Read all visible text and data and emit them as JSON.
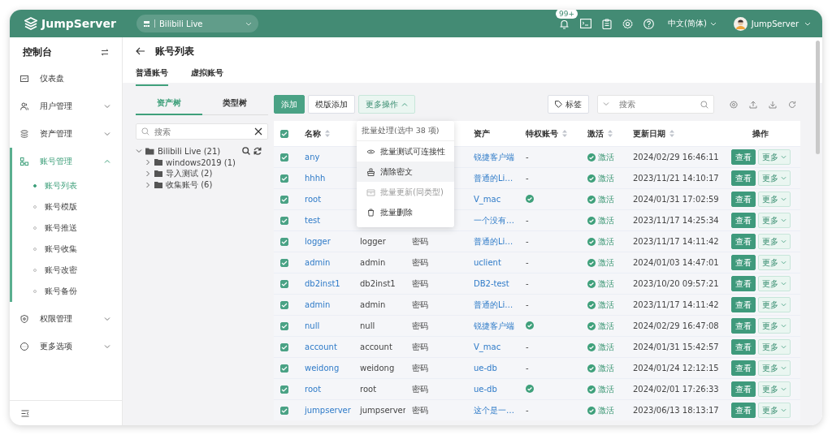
{
  "header": {
    "logo": "JumpServer",
    "org": "Bilibili Live",
    "notification_badge": "99+",
    "language": "中文(简体)",
    "user": "JumpServer"
  },
  "sidebar": {
    "title": "控制台",
    "items": [
      {
        "label": "仪表盘",
        "selected": false
      },
      {
        "label": "用户管理",
        "expanded": false,
        "selected": false
      },
      {
        "label": "资产管理",
        "expanded": false,
        "selected": false
      },
      {
        "label": "账号管理",
        "expanded": true,
        "selected": true,
        "children": [
          {
            "label": "账号列表",
            "selected": true
          },
          {
            "label": "账号模版",
            "selected": false
          },
          {
            "label": "账号推送",
            "selected": false
          },
          {
            "label": "账号收集",
            "selected": false
          },
          {
            "label": "账号改密",
            "selected": false
          },
          {
            "label": "账号备份",
            "selected": false
          }
        ]
      },
      {
        "label": "权限管理",
        "expanded": false,
        "selected": false
      },
      {
        "label": "更多选项",
        "expanded": false,
        "selected": false
      }
    ]
  },
  "page": {
    "title": "账号列表",
    "tabs": [
      {
        "label": "普通账号",
        "selected": true
      },
      {
        "label": "虚拟账号",
        "selected": false
      }
    ]
  },
  "tree": {
    "tabs": [
      {
        "label": "资产树",
        "selected": true
      },
      {
        "label": "类型树",
        "selected": false
      }
    ],
    "search": {
      "placeholder": "搜索"
    },
    "nodes": [
      {
        "label": "Bilibili Live (21)",
        "expanded": true,
        "children": [
          {
            "label": "windows2019 (1)",
            "expanded": false
          },
          {
            "label": "导入测试 (2)",
            "expanded": false
          },
          {
            "label": "收集账号 (6)",
            "expanded": false
          }
        ]
      }
    ]
  },
  "toolbar": {
    "buttons": [
      {
        "label": "添加",
        "kind": "primary"
      },
      {
        "label": "模版添加",
        "kind": "default"
      },
      {
        "label": "更多操作",
        "kind": "menu",
        "open": true
      }
    ],
    "tag_button": "标签",
    "search": {
      "placeholder": "搜索"
    }
  },
  "menu": {
    "title": "批量处理(选中 38 项)",
    "items": [
      {
        "label": "批量测试可连接性",
        "disabled": false,
        "hovered": false
      },
      {
        "label": "清除密文",
        "disabled": false,
        "hovered": true
      },
      {
        "label": "批量更新(同类型)",
        "disabled": true,
        "hovered": false
      },
      {
        "label": "批量删除",
        "disabled": false,
        "hovered": false
      }
    ]
  },
  "table": {
    "all_checked": true,
    "columns": [
      {
        "label": "名称",
        "sortable": true
      },
      {
        "label": "资产",
        "sortable": false
      },
      {
        "label": "特权账号",
        "sortable": true
      },
      {
        "label": "激活",
        "sortable": true
      },
      {
        "label": "更新日期",
        "sortable": true
      },
      {
        "label": "操作",
        "sortable": false
      }
    ],
    "rows": [
      {
        "checked": true,
        "name": "any",
        "asset": "锐捷客户端",
        "privileged": false,
        "privileged_label": "-",
        "active": true,
        "status": "激活",
        "updated": "2024/02/29 16:46:11",
        "actions": [
          "查看",
          "更多"
        ]
      },
      {
        "checked": true,
        "name": "hhhh",
        "asset": "普通的Li…",
        "privileged": false,
        "privileged_label": "-",
        "active": true,
        "status": "激活",
        "updated": "2023/11/21 14:10:17",
        "actions": [
          "查看",
          "更多"
        ]
      },
      {
        "checked": true,
        "name": "root",
        "asset": "V_mac",
        "privileged": true,
        "active": true,
        "status": "激活",
        "updated": "2024/01/31 17:02:59",
        "actions": [
          "查看",
          "更多"
        ]
      },
      {
        "checked": true,
        "name": "test",
        "asset": "一个没有…",
        "privileged": false,
        "privileged_label": "-",
        "active": true,
        "status": "激活",
        "updated": "2023/11/17 14:25:34",
        "actions": [
          "查看",
          "更多"
        ]
      },
      {
        "checked": true,
        "name": "logger",
        "username": "logger",
        "type": "密码",
        "asset": "普通的Li…",
        "privileged": false,
        "privileged_label": "-",
        "active": true,
        "status": "激活",
        "updated": "2023/11/17 14:11:42",
        "actions": [
          "查看",
          "更多"
        ]
      },
      {
        "checked": true,
        "name": "admin",
        "username": "admin",
        "type": "密码",
        "asset": "uclient",
        "privileged": false,
        "privileged_label": "-",
        "active": true,
        "status": "激活",
        "updated": "2024/01/03 14:47:01",
        "actions": [
          "查看",
          "更多"
        ]
      },
      {
        "checked": true,
        "name": "db2inst1",
        "username": "db2inst1",
        "type": "密码",
        "asset": "DB2-test",
        "privileged": false,
        "privileged_label": "-",
        "active": true,
        "status": "激活",
        "updated": "2023/10/20 09:57:21",
        "actions": [
          "查看",
          "更多"
        ]
      },
      {
        "checked": true,
        "name": "admin",
        "username": "admin",
        "type": "密码",
        "asset": "普通的Li…",
        "privileged": false,
        "privileged_label": "-",
        "active": true,
        "status": "激活",
        "updated": "2023/11/17 14:11:42",
        "actions": [
          "查看",
          "更多"
        ]
      },
      {
        "checked": true,
        "name": "null",
        "username": "null",
        "type": "密码",
        "asset": "锐捷客户端",
        "privileged": true,
        "active": true,
        "status": "激活",
        "updated": "2024/02/29 16:47:08",
        "actions": [
          "查看",
          "更多"
        ]
      },
      {
        "checked": true,
        "name": "account",
        "username": "account",
        "type": "密码",
        "asset": "V_mac",
        "privileged": false,
        "privileged_label": "-",
        "active": true,
        "status": "激活",
        "updated": "2024/01/31 15:42:57",
        "actions": [
          "查看",
          "更多"
        ]
      },
      {
        "checked": true,
        "name": "weidong",
        "username": "weidong",
        "type": "密码",
        "asset": "ue-db",
        "privileged": false,
        "privileged_label": "-",
        "active": true,
        "status": "激活",
        "updated": "2024/01/24 12:12:15",
        "actions": [
          "查看",
          "更多"
        ]
      },
      {
        "checked": true,
        "name": "root",
        "username": "root",
        "type": "密码",
        "asset": "ue-db",
        "privileged": true,
        "active": true,
        "status": "激活",
        "updated": "2024/02/01 17:26:33",
        "actions": [
          "查看",
          "更多"
        ]
      },
      {
        "checked": true,
        "name": "jumpserver",
        "username": "jumpserver",
        "type": "密码",
        "asset": "这个是一…",
        "privileged": false,
        "privileged_label": "-",
        "active": true,
        "status": "激活",
        "updated": "2023/06/13 18:13:17",
        "actions": [
          "查看",
          "更多"
        ]
      }
    ]
  }
}
